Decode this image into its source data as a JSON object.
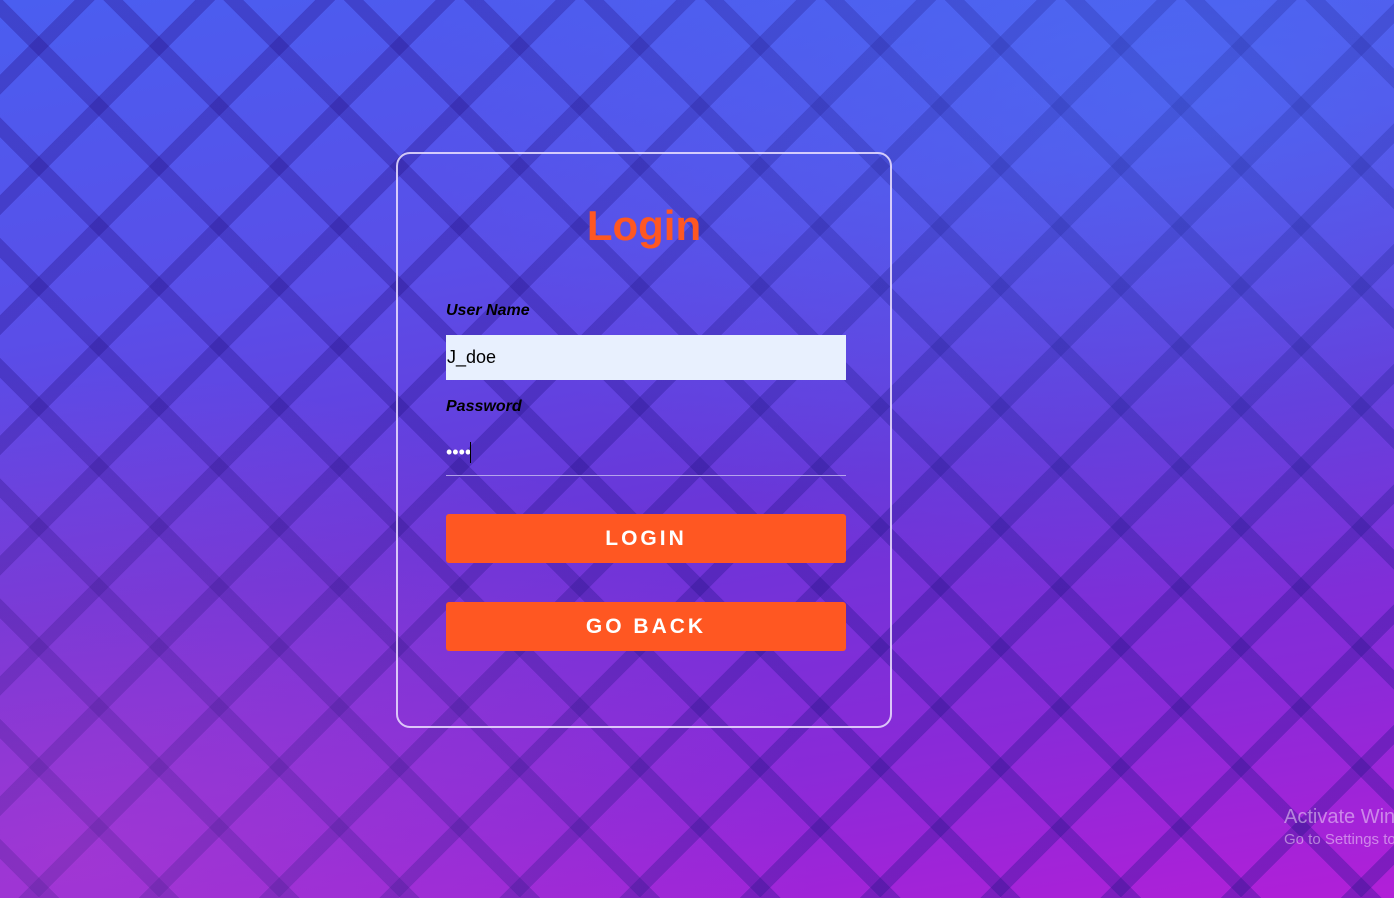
{
  "form": {
    "title": "Login",
    "username_label": "User Name",
    "username_value": "J_doe",
    "password_label": "Password",
    "password_value": "••••",
    "login_button": "LOGIN",
    "back_button": "GO BACK"
  },
  "watermark": {
    "title": "Activate Win",
    "subtitle": "Go to Settings to"
  },
  "colors": {
    "accent": "#ff5722",
    "input_bg": "#e8f0fe"
  }
}
